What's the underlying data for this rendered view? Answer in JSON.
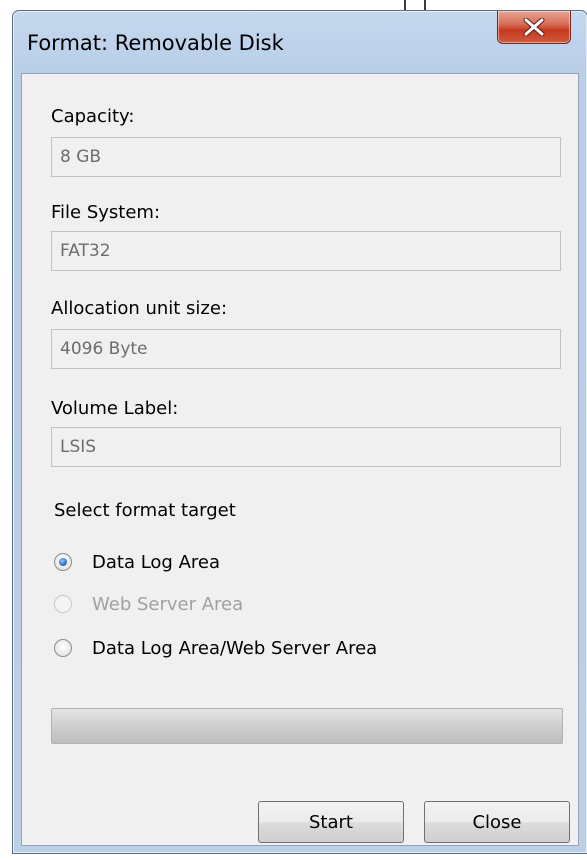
{
  "window": {
    "title": "Format: Removable Disk",
    "close_icon": "close-x-icon"
  },
  "fields": {
    "capacity_label": "Capacity:",
    "capacity_value": "8 GB",
    "filesystem_label": "File System:",
    "filesystem_value": "FAT32",
    "alloc_label": "Allocation unit size:",
    "alloc_value": "4096 Byte",
    "volume_label": "Volume Label:",
    "volume_value": "LSIS"
  },
  "format_target": {
    "heading": "Select format target",
    "options": [
      {
        "label": "Data Log Area",
        "checked": true,
        "enabled": true
      },
      {
        "label": "Web Server Area",
        "checked": false,
        "enabled": false
      },
      {
        "label": "Data Log Area/Web Server Area",
        "checked": false,
        "enabled": true
      }
    ]
  },
  "progress": {
    "value_percent": 0
  },
  "buttons": {
    "start": "Start",
    "close": "Close"
  },
  "colors": {
    "frame": "#bcd0e6",
    "client": "#f0f0f0",
    "close_button": "#c4391f",
    "radio_selected": "#2f76c9"
  }
}
